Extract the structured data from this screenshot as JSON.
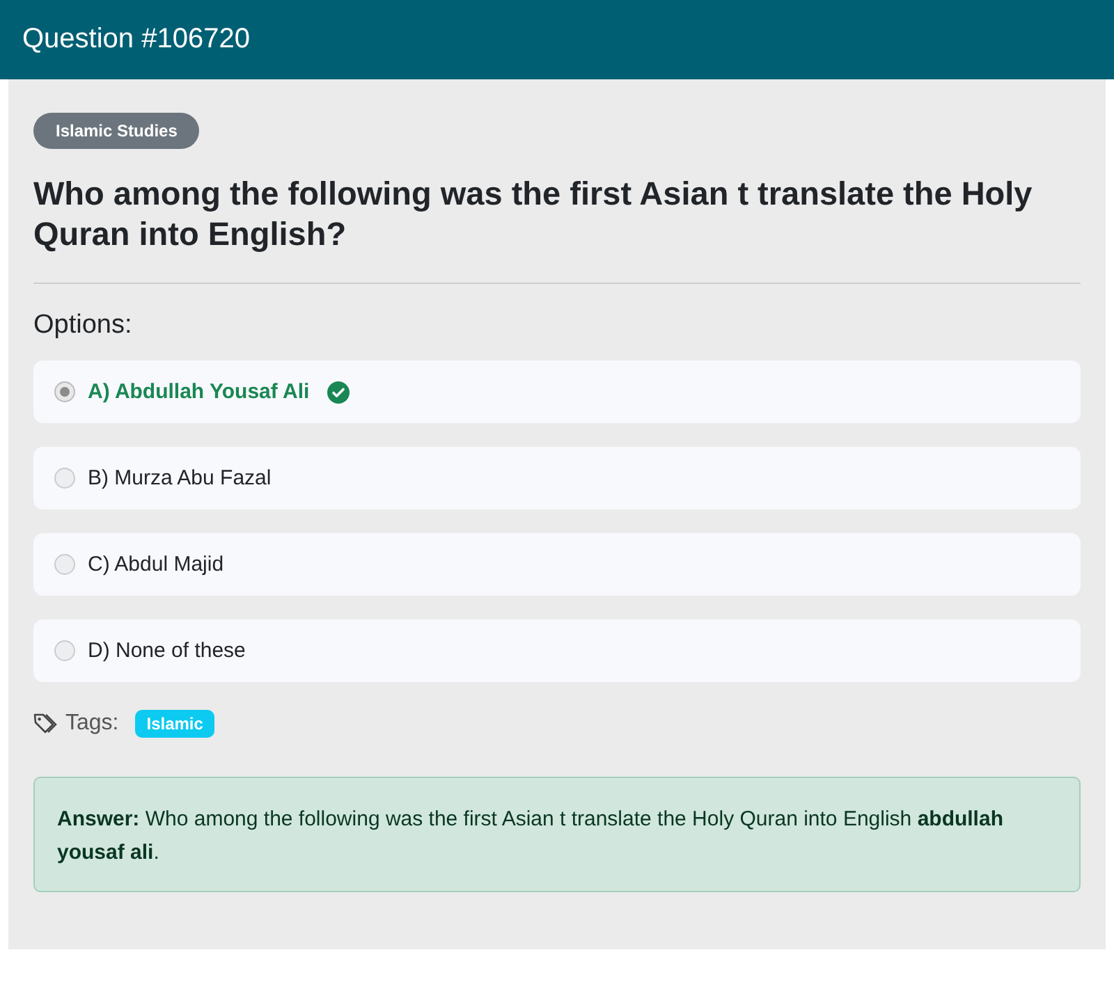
{
  "header": {
    "title": "Question #106720"
  },
  "category": "Islamic Studies",
  "question": "Who among the following was the first Asian t translate the Holy Quran into English?",
  "options_label": "Options:",
  "options": [
    {
      "label": "A) Abdullah Yousaf Ali",
      "selected": true,
      "correct": true
    },
    {
      "label": "B) Murza Abu Fazal",
      "selected": false,
      "correct": false
    },
    {
      "label": "C) Abdul Majid",
      "selected": false,
      "correct": false
    },
    {
      "label": "D) None of these",
      "selected": false,
      "correct": false
    }
  ],
  "tags_label": "Tags:",
  "tags": [
    "Islamic"
  ],
  "answer": "**Answer:** Who among the following was the first Asian t translate the Holy Quran into English **abdullah yousaf ali**."
}
